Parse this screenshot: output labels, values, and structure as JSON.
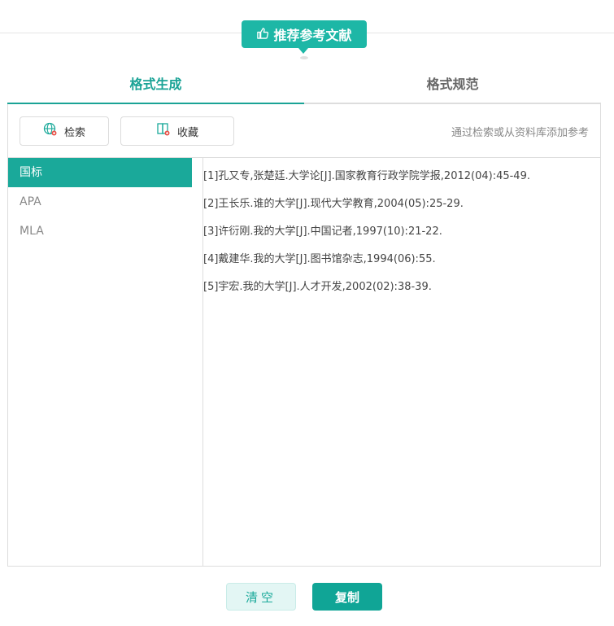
{
  "header": {
    "badge_label": "推荐参考文献"
  },
  "tabs": [
    {
      "label": "格式生成",
      "active": true
    },
    {
      "label": "格式规范",
      "active": false
    }
  ],
  "toolbar": {
    "search_label": "检索",
    "collect_label": "收藏",
    "tip": "通过检索或从资料库添加参考"
  },
  "formats": [
    {
      "label": "国标",
      "active": true
    },
    {
      "label": "APA",
      "active": false
    },
    {
      "label": "MLA",
      "active": false
    }
  ],
  "references": [
    "[1]孔又专,张楚廷.大学论[J].国家教育行政学院学报,2012(04):45-49.",
    "[2]王长乐.谁的大学[J].现代大学教育,2004(05):25-29.",
    "[3]许衍刚.我的大学[J].中国记者,1997(10):21-22.",
    "[4]戴建华.我的大学[J].图书馆杂志,1994(06):55.",
    "[5]宇宏.我的大学[J].人才开发,2002(02):38-39."
  ],
  "actions": {
    "clear_label": "清空",
    "copy_label": "复制"
  },
  "colors": {
    "accent": "#1aa99a",
    "badge": "#1db7a6"
  },
  "icons": {
    "badge": "thumbs-up-icon",
    "search": "globe-search-icon",
    "collect": "book-add-icon"
  }
}
